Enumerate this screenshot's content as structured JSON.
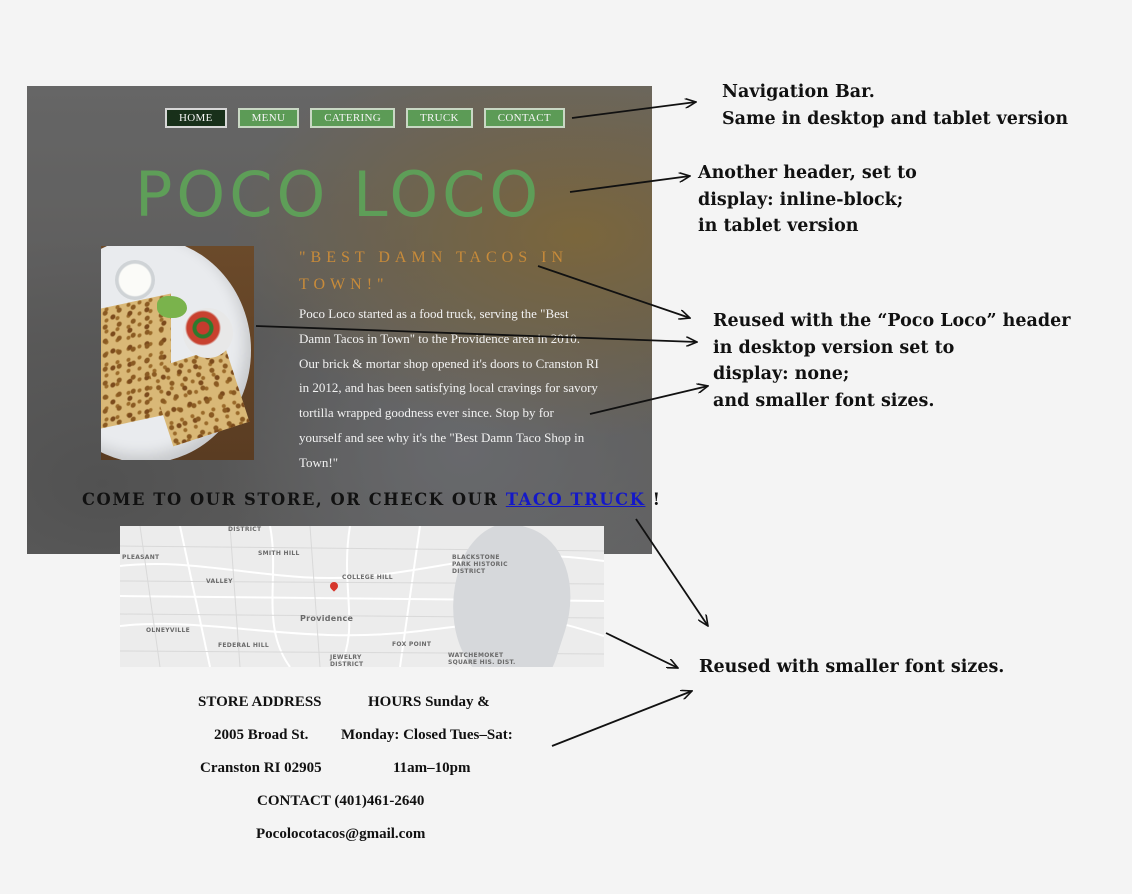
{
  "nav": {
    "items": [
      "HOME",
      "MENU",
      "CATERING",
      "TRUCK",
      "CONTACT"
    ],
    "active": "HOME"
  },
  "brand": "POCO LOCO",
  "hero": {
    "quote": "\"BEST DAMN TACOS IN TOWN!\"",
    "intro": "Poco Loco started as a food truck, serving the \"Best Damn Tacos in Town\" to the Providence area in 2010. Our brick & mortar shop opened it's doors to Cranston RI in 2012, and has been satisfying local cravings for savory tortilla wrapped goodness ever since. Stop by for yourself and see why it's the \"Best Damn Taco Shop in Town!\""
  },
  "visit": {
    "prefix": "COME TO OUR STORE, OR CHECK OUR",
    "link": "TACO TRUCK",
    "suffix": "!"
  },
  "map": {
    "labels": [
      "DISTRICT",
      "SMITH HILL",
      "PLEASANT",
      "VALLEY",
      "COLLEGE HILL",
      "BLACKSTONE PARK HISTORIC DISTRICT",
      "Providence",
      "OLNEYVILLE",
      "FEDERAL HILL",
      "FOX POINT",
      "JEWELRY DISTRICT",
      "WATCHEMOKET SQUARE HIS. DIST."
    ]
  },
  "store": {
    "address_title": "STORE ADDRESS",
    "address_line1": "2005 Broad St.",
    "address_line2": "Cranston RI 02905",
    "hours_line1": "HOURS Sunday &",
    "hours_line2": "Monday: Closed Tues–Sat:",
    "hours_line3": "11am–10pm",
    "contact": "CONTACT (401)461-2640",
    "email": "Pocolocotacos@gmail.com"
  },
  "annotations": {
    "nav_line1": "Navigation Bar.",
    "nav_line2": "Same in desktop and tablet version",
    "header_line1": "Another header, set to",
    "header_line2": "display: inline-block;",
    "header_line3": "in tablet version",
    "reuse_line1": "Reused with the “Poco Loco” header",
    "reuse_line2": "in desktop version set to",
    "reuse_line3": "display: none;",
    "reuse_line4": "and smaller font sizes.",
    "fonts_line1": "Reused with smaller font sizes."
  }
}
